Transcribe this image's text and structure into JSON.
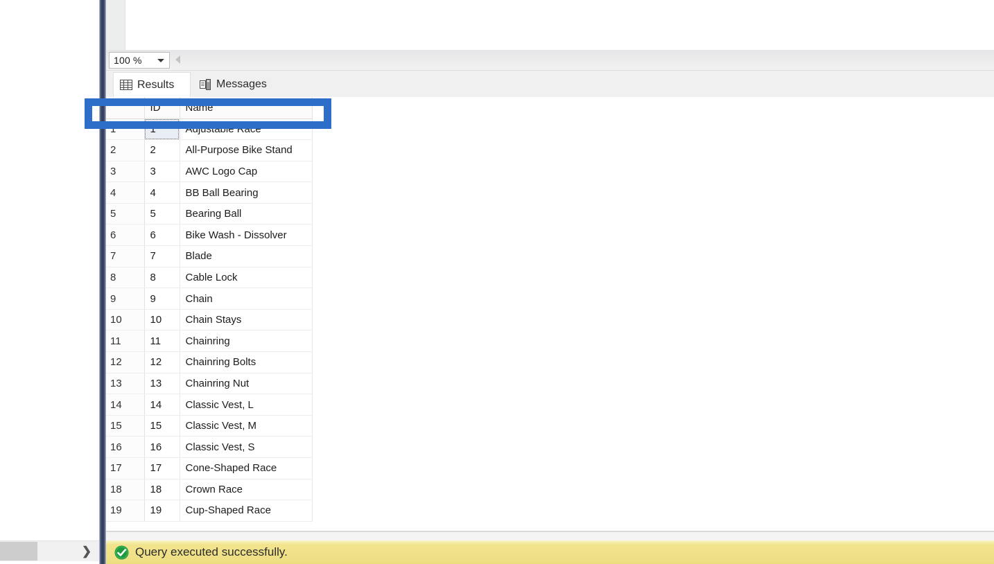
{
  "zoom_bar": {
    "zoom_value": "100 %",
    "caret_icon": "chevron-down-icon",
    "splitter_icon": "chevron-left-icon"
  },
  "tabs": [
    {
      "label": "Results",
      "icon": "grid-icon",
      "active": true
    },
    {
      "label": "Messages",
      "icon": "messages-icon",
      "active": false
    }
  ],
  "grid": {
    "columns": [
      "",
      "ID",
      "Name"
    ],
    "rows": [
      {
        "num": "1",
        "id": "1",
        "name": "Adjustable Race"
      },
      {
        "num": "2",
        "id": "2",
        "name": "All-Purpose Bike Stand"
      },
      {
        "num": "3",
        "id": "3",
        "name": "AWC Logo Cap"
      },
      {
        "num": "4",
        "id": "4",
        "name": "BB Ball Bearing"
      },
      {
        "num": "5",
        "id": "5",
        "name": "Bearing Ball"
      },
      {
        "num": "6",
        "id": "6",
        "name": "Bike Wash - Dissolver"
      },
      {
        "num": "7",
        "id": "7",
        "name": "Blade"
      },
      {
        "num": "8",
        "id": "8",
        "name": "Cable Lock"
      },
      {
        "num": "9",
        "id": "9",
        "name": "Chain"
      },
      {
        "num": "10",
        "id": "10",
        "name": "Chain Stays"
      },
      {
        "num": "11",
        "id": "11",
        "name": "Chainring"
      },
      {
        "num": "12",
        "id": "12",
        "name": "Chainring Bolts"
      },
      {
        "num": "13",
        "id": "13",
        "name": "Chainring Nut"
      },
      {
        "num": "14",
        "id": "14",
        "name": "Classic Vest, L"
      },
      {
        "num": "15",
        "id": "15",
        "name": "Classic Vest, M"
      },
      {
        "num": "16",
        "id": "16",
        "name": "Classic Vest, S"
      },
      {
        "num": "17",
        "id": "17",
        "name": "Cone-Shaped Race"
      },
      {
        "num": "18",
        "id": "18",
        "name": "Crown Race"
      },
      {
        "num": "19",
        "id": "19",
        "name": "Cup-Shaped Race"
      }
    ],
    "focused_cell": {
      "row": 0,
      "column": "ID"
    }
  },
  "status": {
    "icon": "success-check-icon",
    "message": "Query executed successfully."
  },
  "scrollbar": {
    "arrow_icon": "chevron-right-icon"
  },
  "annotation": {
    "shape": "rectangle-highlight",
    "color": "#2d6fc8",
    "target": "grid-header-row"
  }
}
